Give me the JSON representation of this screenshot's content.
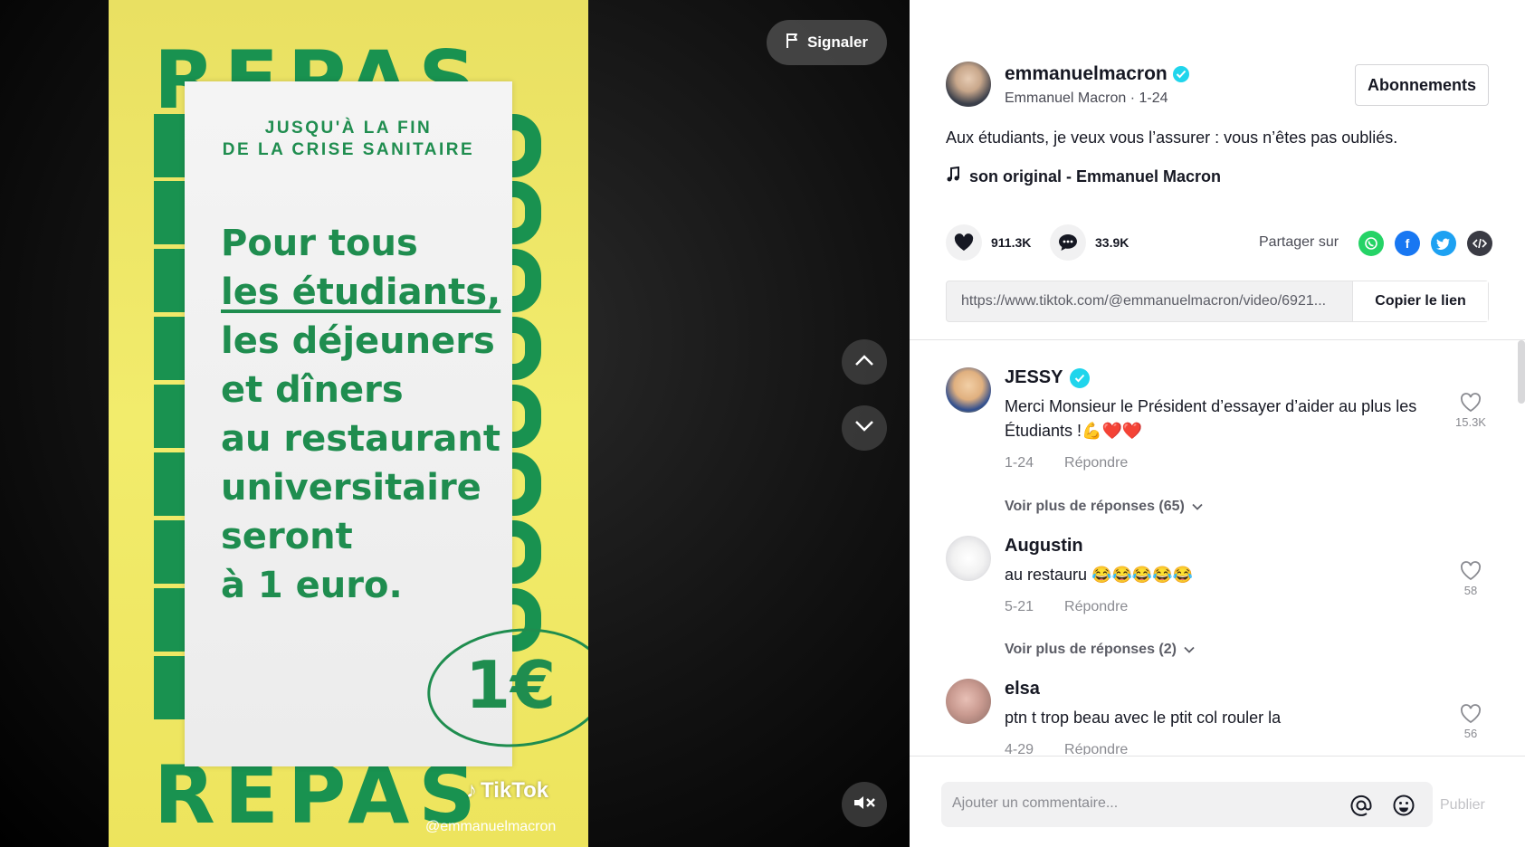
{
  "video": {
    "repas_word": "REPAS",
    "card_top": "JUSQU'À LA FIN\nDE LA CRISE SANITAIRE",
    "card_lines": [
      "Pour tous",
      "les étudiants,",
      "les déjeuners",
      "et dîners",
      "au restaurant",
      "universitaire",
      "seront",
      "à 1 euro."
    ],
    "euro_badge": "1€",
    "watermark": "TikTok",
    "watermark_handle": "@emmanuelmacron",
    "report_label": "Signaler"
  },
  "author": {
    "username": "emmanuelmacron",
    "display": "Emmanuel Macron · 1-24",
    "follow_label": "Abonnements",
    "caption": "Aux étudiants, je veux vous l’assurer : vous n’êtes pas oubliés.",
    "music": "son original - Emmanuel Macron"
  },
  "stats": {
    "likes": "911.3K",
    "comments": "33.9K",
    "share_label": "Partager sur"
  },
  "link": {
    "url": "https://www.tiktok.com/@emmanuelmacron/video/6921...",
    "copy_label": "Copier le lien"
  },
  "comments": [
    {
      "user": "JESSY",
      "verified": true,
      "text": "Merci Monsieur le Président d’essayer d’aider au plus les Étudiants !💪❤️❤️",
      "date": "1-24",
      "reply": "Répondre",
      "likes": "15.3K",
      "more": "Voir plus de réponses (65)"
    },
    {
      "user": "Augustin",
      "verified": false,
      "text": "au restauru 😂😂😂😂😂",
      "date": "5-21",
      "reply": "Répondre",
      "likes": "58",
      "more": "Voir plus de réponses (2)"
    },
    {
      "user": "elsa",
      "verified": false,
      "text": "ptn t trop beau avec le ptit col rouler la",
      "date": "4-29",
      "reply": "Répondre",
      "likes": "56",
      "more": ""
    }
  ],
  "composer": {
    "placeholder": "Ajouter un commentaire...",
    "publish_label": "Publier"
  },
  "colors": {
    "video_yellow": "#efe766",
    "brand_green": "#1f8d4f",
    "verified": "#20d5ec",
    "whatsapp": "#25d366",
    "facebook": "#1877f2",
    "twitter": "#1da1f2",
    "embed": "#3a3b44"
  },
  "icons": [
    "flag-icon",
    "chevron-up-icon",
    "chevron-down-icon",
    "mute-icon",
    "verified-icon",
    "music-note-icon",
    "heart-icon",
    "comment-icon",
    "whatsapp-icon",
    "facebook-icon",
    "twitter-icon",
    "embed-icon",
    "mention-icon",
    "emoji-icon"
  ]
}
